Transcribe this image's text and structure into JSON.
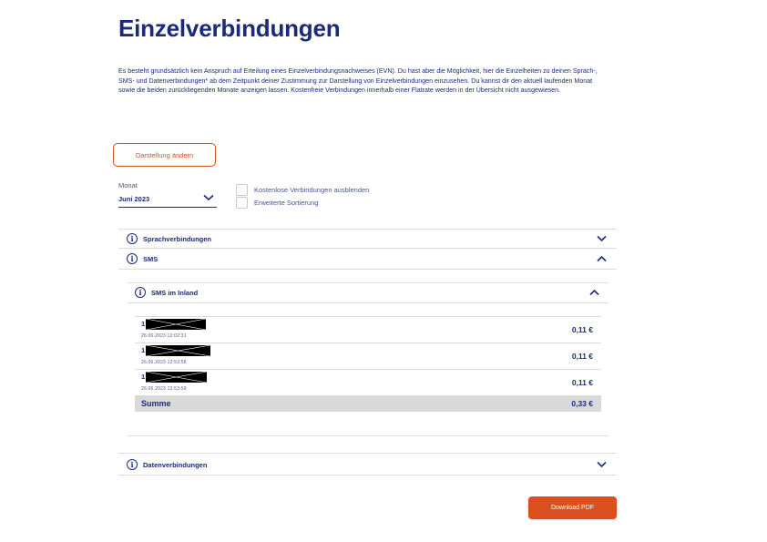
{
  "page": {
    "title": "Einzelverbindungen",
    "intro": "Es besteht grundsätzlich kein Anspruch auf Erteilung eines Einzelverbindungsnachweises (EVN). Du hast aber die Möglichkeit, hier die Einzelheiten zu deinen Sprach-, SMS- und Datenverbindungen* ab dem Zeitpunkt deiner Zustimmung zur Darstellung von Einzelverbindungen einzusehen. Du kannst dir den aktuell laufenden Monat sowie die beiden zurückliegenden Monate anzeigen lassen. Kostenfreie Verbindungen innerhalb einer Flatrate werden in der Übersicht nicht ausgewiesen."
  },
  "controls": {
    "change_view_label": "Darstellung ändern",
    "month_label": "Monat",
    "month_value": "Juni 2023",
    "hide_free_label": "Kostenlose Verbindungen ausblenden",
    "advanced_sort_label": "Erweiterte Sortierung"
  },
  "sections": {
    "voice": "Sprachverbindungen",
    "sms": "SMS",
    "sms_domestic": "SMS im Inland",
    "data": "Datenverbindungen"
  },
  "sms_entries": [
    {
      "number_prefix": "1",
      "date": "26.06.2023 12:02:31",
      "price": "0,11 €"
    },
    {
      "number_prefix": "1",
      "date": "26.06.2023 12:53:58",
      "price": "0,11 €"
    },
    {
      "number_prefix": "1",
      "date": "26.06.2023 12:53:59",
      "price": "0,11 €"
    }
  ],
  "sum": {
    "label": "Summe",
    "value": "0,33 €"
  },
  "download_label": "Download PDF",
  "colors": {
    "primary": "#1b2a7a",
    "accent": "#d9501e",
    "sum_bg": "#d9d9d9"
  }
}
